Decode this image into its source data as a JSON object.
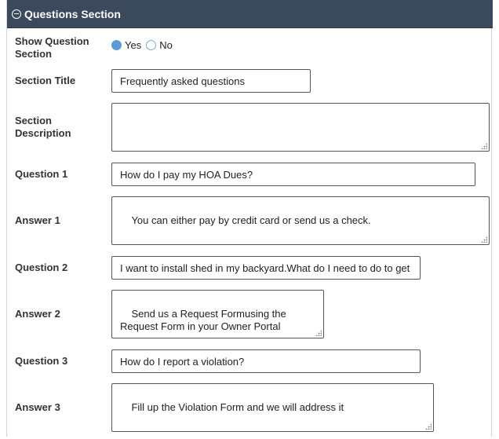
{
  "section": {
    "title": "Questions Section"
  },
  "show_section": {
    "label": "Show Question\nSection",
    "options": [
      {
        "label": "Yes",
        "selected": true
      },
      {
        "label": "No",
        "selected": false
      }
    ]
  },
  "section_title": {
    "label": "Section Title",
    "value": "Frequently asked questions"
  },
  "section_description": {
    "label": "Section\nDescription",
    "value": ""
  },
  "qa": [
    {
      "question_label": "Question 1",
      "question": "How do I pay my HOA Dues?",
      "answer_label": "Answer 1",
      "answer": "You can either pay by credit card or send us a check."
    },
    {
      "question_label": "Question 2",
      "question": "I want to install shed in my backyard.What do I need to do to get",
      "answer_label": "Answer 2",
      "answer": "Send us a Request Formusing the\nRequest Form in your Owner Portal"
    },
    {
      "question_label": "Question 3",
      "question": " How do I report a violation?",
      "answer_label": "Answer 3",
      "answer": "Fill up the Violation Form and we will address it"
    }
  ],
  "colors": {
    "header_bg": "#3a4a5c",
    "radio_selected": "#5b9bd5"
  }
}
